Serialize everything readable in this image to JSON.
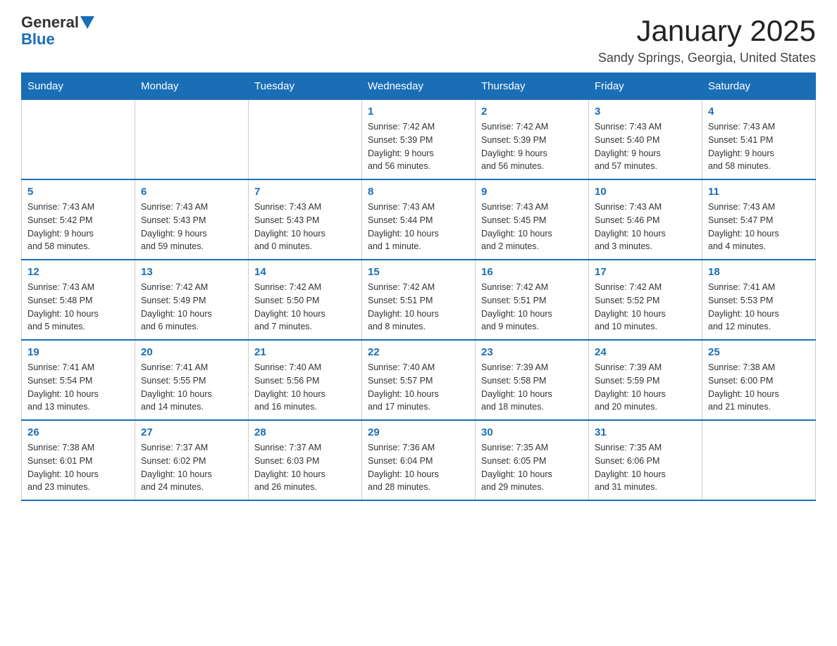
{
  "header": {
    "logo": {
      "general": "General",
      "blue": "Blue"
    },
    "title": "January 2025",
    "subtitle": "Sandy Springs, Georgia, United States"
  },
  "weekdays": [
    "Sunday",
    "Monday",
    "Tuesday",
    "Wednesday",
    "Thursday",
    "Friday",
    "Saturday"
  ],
  "weeks": [
    [
      {
        "day": "",
        "detail": ""
      },
      {
        "day": "",
        "detail": ""
      },
      {
        "day": "",
        "detail": ""
      },
      {
        "day": "1",
        "detail": "Sunrise: 7:42 AM\nSunset: 5:39 PM\nDaylight: 9 hours\nand 56 minutes."
      },
      {
        "day": "2",
        "detail": "Sunrise: 7:42 AM\nSunset: 5:39 PM\nDaylight: 9 hours\nand 56 minutes."
      },
      {
        "day": "3",
        "detail": "Sunrise: 7:43 AM\nSunset: 5:40 PM\nDaylight: 9 hours\nand 57 minutes."
      },
      {
        "day": "4",
        "detail": "Sunrise: 7:43 AM\nSunset: 5:41 PM\nDaylight: 9 hours\nand 58 minutes."
      }
    ],
    [
      {
        "day": "5",
        "detail": "Sunrise: 7:43 AM\nSunset: 5:42 PM\nDaylight: 9 hours\nand 58 minutes."
      },
      {
        "day": "6",
        "detail": "Sunrise: 7:43 AM\nSunset: 5:43 PM\nDaylight: 9 hours\nand 59 minutes."
      },
      {
        "day": "7",
        "detail": "Sunrise: 7:43 AM\nSunset: 5:43 PM\nDaylight: 10 hours\nand 0 minutes."
      },
      {
        "day": "8",
        "detail": "Sunrise: 7:43 AM\nSunset: 5:44 PM\nDaylight: 10 hours\nand 1 minute."
      },
      {
        "day": "9",
        "detail": "Sunrise: 7:43 AM\nSunset: 5:45 PM\nDaylight: 10 hours\nand 2 minutes."
      },
      {
        "day": "10",
        "detail": "Sunrise: 7:43 AM\nSunset: 5:46 PM\nDaylight: 10 hours\nand 3 minutes."
      },
      {
        "day": "11",
        "detail": "Sunrise: 7:43 AM\nSunset: 5:47 PM\nDaylight: 10 hours\nand 4 minutes."
      }
    ],
    [
      {
        "day": "12",
        "detail": "Sunrise: 7:43 AM\nSunset: 5:48 PM\nDaylight: 10 hours\nand 5 minutes."
      },
      {
        "day": "13",
        "detail": "Sunrise: 7:42 AM\nSunset: 5:49 PM\nDaylight: 10 hours\nand 6 minutes."
      },
      {
        "day": "14",
        "detail": "Sunrise: 7:42 AM\nSunset: 5:50 PM\nDaylight: 10 hours\nand 7 minutes."
      },
      {
        "day": "15",
        "detail": "Sunrise: 7:42 AM\nSunset: 5:51 PM\nDaylight: 10 hours\nand 8 minutes."
      },
      {
        "day": "16",
        "detail": "Sunrise: 7:42 AM\nSunset: 5:51 PM\nDaylight: 10 hours\nand 9 minutes."
      },
      {
        "day": "17",
        "detail": "Sunrise: 7:42 AM\nSunset: 5:52 PM\nDaylight: 10 hours\nand 10 minutes."
      },
      {
        "day": "18",
        "detail": "Sunrise: 7:41 AM\nSunset: 5:53 PM\nDaylight: 10 hours\nand 12 minutes."
      }
    ],
    [
      {
        "day": "19",
        "detail": "Sunrise: 7:41 AM\nSunset: 5:54 PM\nDaylight: 10 hours\nand 13 minutes."
      },
      {
        "day": "20",
        "detail": "Sunrise: 7:41 AM\nSunset: 5:55 PM\nDaylight: 10 hours\nand 14 minutes."
      },
      {
        "day": "21",
        "detail": "Sunrise: 7:40 AM\nSunset: 5:56 PM\nDaylight: 10 hours\nand 16 minutes."
      },
      {
        "day": "22",
        "detail": "Sunrise: 7:40 AM\nSunset: 5:57 PM\nDaylight: 10 hours\nand 17 minutes."
      },
      {
        "day": "23",
        "detail": "Sunrise: 7:39 AM\nSunset: 5:58 PM\nDaylight: 10 hours\nand 18 minutes."
      },
      {
        "day": "24",
        "detail": "Sunrise: 7:39 AM\nSunset: 5:59 PM\nDaylight: 10 hours\nand 20 minutes."
      },
      {
        "day": "25",
        "detail": "Sunrise: 7:38 AM\nSunset: 6:00 PM\nDaylight: 10 hours\nand 21 minutes."
      }
    ],
    [
      {
        "day": "26",
        "detail": "Sunrise: 7:38 AM\nSunset: 6:01 PM\nDaylight: 10 hours\nand 23 minutes."
      },
      {
        "day": "27",
        "detail": "Sunrise: 7:37 AM\nSunset: 6:02 PM\nDaylight: 10 hours\nand 24 minutes."
      },
      {
        "day": "28",
        "detail": "Sunrise: 7:37 AM\nSunset: 6:03 PM\nDaylight: 10 hours\nand 26 minutes."
      },
      {
        "day": "29",
        "detail": "Sunrise: 7:36 AM\nSunset: 6:04 PM\nDaylight: 10 hours\nand 28 minutes."
      },
      {
        "day": "30",
        "detail": "Sunrise: 7:35 AM\nSunset: 6:05 PM\nDaylight: 10 hours\nand 29 minutes."
      },
      {
        "day": "31",
        "detail": "Sunrise: 7:35 AM\nSunset: 6:06 PM\nDaylight: 10 hours\nand 31 minutes."
      },
      {
        "day": "",
        "detail": ""
      }
    ]
  ]
}
